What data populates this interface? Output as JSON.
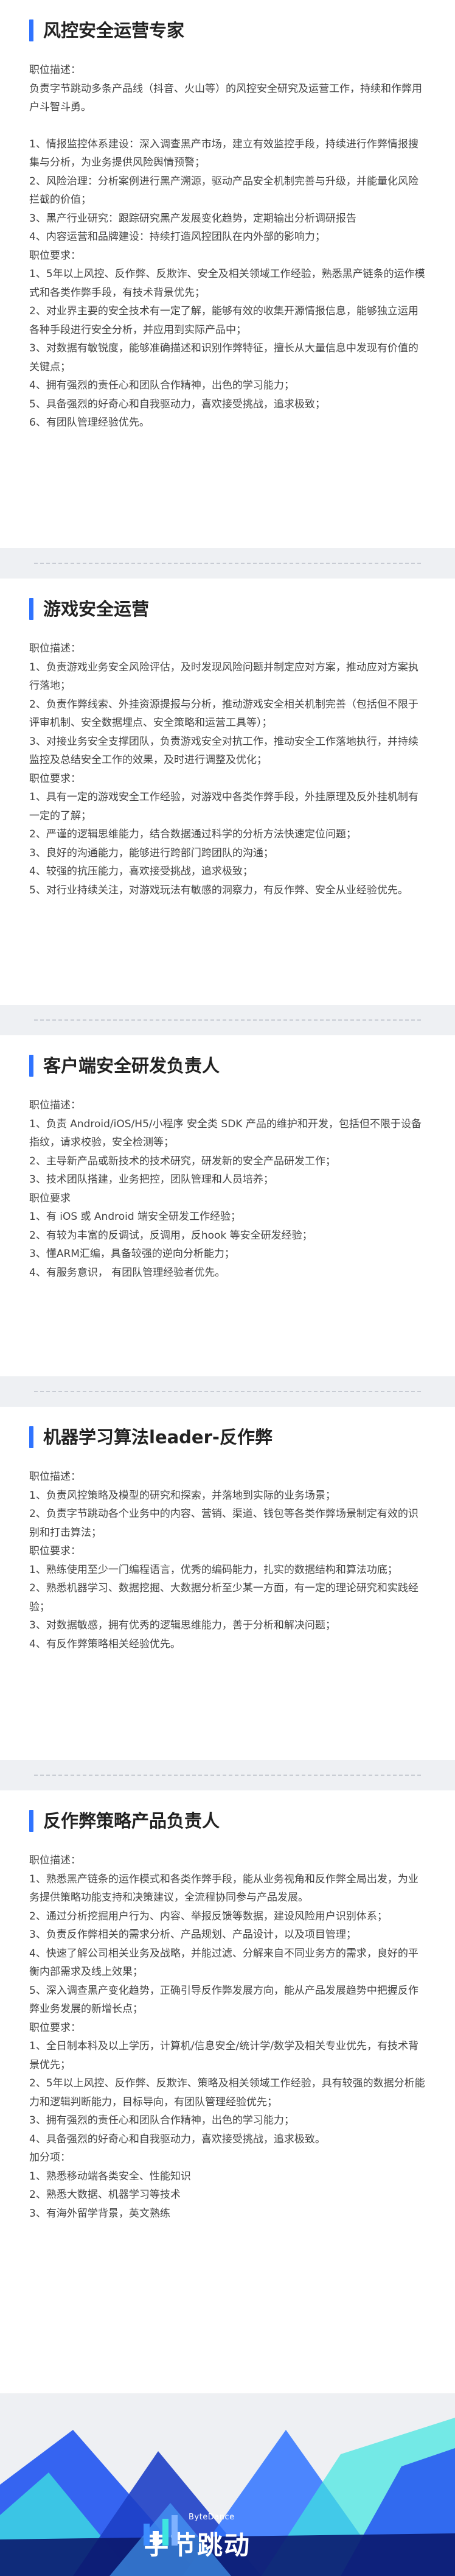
{
  "sections": [
    {
      "title": "风控安全运营专家",
      "lines": [
        "职位描述：",
        "负责字节跳动多条产品线（抖音、火山等）的风控安全研究及运营工作，持续和作弊用户斗智斗勇。",
        "",
        "1、情报监控体系建设：深入调查黑产市场，建立有效监控手段，持续进行作弊情报搜集与分析，为业务提供风险舆情预警；",
        "2、风险治理：分析案例进行黑产溯源，驱动产品安全机制完善与升级，并能量化风险拦截的价值；",
        "3、黑产行业研究：跟踪研究黑产发展变化趋势，定期输出分析调研报告",
        "4、内容运营和品牌建设：持续打造风控团队在内外部的影响力；",
        "职位要求：",
        "1、5年以上风控、反作弊、反欺诈、安全及相关领域工作经验，熟悉黑产链条的运作模式和各类作弊手段，有技术背景优先；",
        "2、对业界主要的安全技术有一定了解，能够有效的收集开源情报信息，能够独立运用各种手段进行安全分析，并应用到实际产品中；",
        "3、对数据有敏锐度，能够准确描述和识别作弊特征，擅长从大量信息中发现有价值的关键点；",
        "4、拥有强烈的责任心和团队合作精神，出色的学习能力；",
        "5、具备强烈的好奇心和自我驱动力，喜欢接受挑战，追求极致；",
        "6、有团队管理经验优先。"
      ]
    },
    {
      "title": "游戏安全运营",
      "lines": [
        "职位描述：",
        "1、负责游戏业务安全风险评估，及时发现风险问题并制定应对方案，推动应对方案执行落地；",
        "2、负责作弊线索、外挂资源提报与分析，推动游戏安全相关机制完善（包括但不限于评审机制、安全数据埋点、安全策略和运营工具等）；",
        "3、对接业务安全支撑团队，负责游戏安全对抗工作，推动安全工作落地执行，并持续监控及总结安全工作的效果，及时进行调整及优化；",
        "职位要求：",
        "1、具有一定的游戏安全工作经验，对游戏中各类作弊手段，外挂原理及反外挂机制有一定的了解；",
        "2、严谨的逻辑思维能力，结合数据通过科学的分析方法快速定位问题；",
        "3、良好的沟通能力，能够进行跨部门跨团队的沟通；",
        "4、较强的抗压能力，喜欢接受挑战，追求极致；",
        "5、对行业持续关注，对游戏玩法有敏感的洞察力，有反作弊、安全从业经验优先。"
      ]
    },
    {
      "title": "客户端安全研发负责人",
      "lines": [
        "职位描述：",
        "1、负责 Android/iOS/H5/小程序 安全类 SDK 产品的维护和开发，包括但不限于设备指纹，请求校验，安全检测等；",
        "2、主导新产品或新技术的技术研究，研发新的安全产品研发工作；",
        "3、技术团队搭建，业务把控，团队管理和人员培养；",
        "职位要求",
        "1、有 iOS 或 Android 端安全研发工作经验；",
        "2、有较为丰富的反调试，反调用，反hook 等安全研发经验；",
        "3、懂ARM汇编，具备较强的逆向分析能力；",
        "4、有服务意识，  有团队管理经验者优先。"
      ]
    },
    {
      "title": "机器学习算法leader-反作弊",
      "lines": [
        "职位描述：",
        "1、负责风控策略及模型的研究和探索，并落地到实际的业务场景；",
        "2、负责字节跳动各个业务中的内容、营销、渠道、钱包等各类作弊场景制定有效的识别和打击算法；",
        "职位要求：",
        "1、熟练使用至少一门编程语言，优秀的编码能力，扎实的数据结构和算法功底；",
        "2、熟悉机器学习、数据挖掘、大数据分析至少某一方面，有一定的理论研究和实践经验；",
        "3、对数据敏感，拥有优秀的逻辑思维能力，善于分析和解决问题；",
        "4、有反作弊策略相关经验优先。"
      ]
    },
    {
      "title": "反作弊策略产品负责人",
      "lines": [
        "职位描述：",
        "1、熟悉黑产链条的运作模式和各类作弊手段，能从业务视角和反作弊全局出发，为业务提供策略功能支持和决策建议，全流程协同参与产品发展。",
        "2、通过分析挖掘用户行为、内容、举报反馈等数据，建设风险用户识别体系；",
        "3、负责反作弊相关的需求分析、产品规划、产品设计，以及项目管理；",
        "4、快速了解公司相关业务及战略，并能过滤、分解来自不同业务方的需求，良好的平衡内部需求及线上效果；",
        "5、深入调查黑产变化趋势，正确引导反作弊发展方向，能从产品发展趋势中把握反作弊业务发展的新增长点；",
        "职位要求：",
        "1、全日制本科及以上学历，计算机/信息安全/统计学/数学及相关专业优先，有技术背景优先；",
        "2、5年以上风控、反作弊、反欺诈、策略及相关领域工作经验，具有较强的数据分析能力和逻辑判断能力，目标导向，有团队管理经验优先；",
        "3、拥有强烈的责任心和团队合作精神，出色的学习能力；",
        "4、具备强烈的好奇心和自我驱动力，喜欢接受挑战，追求极致。",
        "加分项：",
        "1、熟悉移动端各类安全、性能知识",
        "2、熟悉大数据、机器学习等技术",
        "3、有海外留学背景，英文熟练"
      ]
    }
  ],
  "footer": {
    "brand_en": "ByteDance",
    "brand_cn": "字节跳动",
    "logo_icon": "bytedance-logo-icon"
  },
  "colors": {
    "accent": "#2f73ff",
    "background": "#eef0f3",
    "footer_blue": "#2a5cf0",
    "footer_cyan": "#3ee6e0",
    "footer_navy": "#0b1a6e"
  }
}
